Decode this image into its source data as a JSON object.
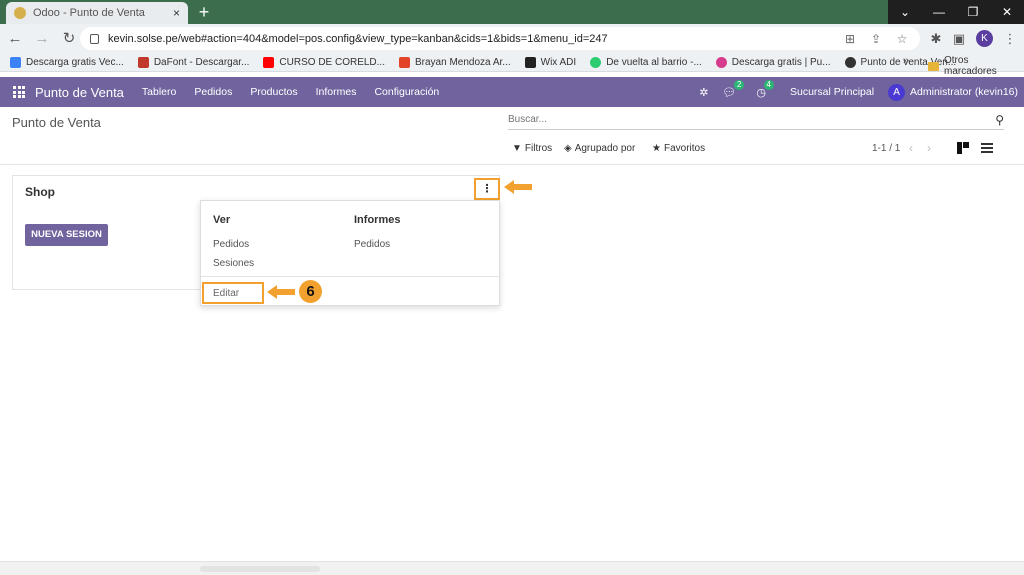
{
  "browser": {
    "tab_title": "Odoo - Punto de Venta",
    "tab_close": "×",
    "new_tab": "+",
    "url": "kevin.solse.pe/web#action=404&model=pos.config&view_type=kanban&cids=1&bids=1&menu_id=247",
    "profile_initial": "K",
    "window_controls": [
      "⌄",
      "—",
      "❐",
      "✕"
    ],
    "bookmarks": [
      {
        "label": "Descarga gratis Vec...",
        "color": "#3b82f6"
      },
      {
        "label": "DaFont - Descargar...",
        "color": "#c0392b"
      },
      {
        "label": "CURSO DE CORELD...",
        "color": "#ff0000"
      },
      {
        "label": "Brayan Mendoza Ar...",
        "color": "#e24329"
      },
      {
        "label": "Wix ADI",
        "color": "#222222"
      },
      {
        "label": "De vuelta al barrio -...",
        "color": "#2ecc71"
      },
      {
        "label": "Descarga gratis | Pu...",
        "color": "#d63c8c"
      },
      {
        "label": "Punto de venta Ven...",
        "color": "#333333"
      }
    ],
    "bookmarks_more": "»",
    "other_bookmarks": "Otros marcadores"
  },
  "navbar": {
    "brand": "Punto de Venta",
    "menu": [
      "Tablero",
      "Pedidos",
      "Productos",
      "Informes",
      "Configuración"
    ],
    "messages_badge": "2",
    "activities_badge": "4",
    "company": "Sucursal Principal",
    "user_initial": "A",
    "user_name": "Administrator (kevin16)"
  },
  "control_panel": {
    "breadcrumb": "Punto de Venta",
    "search_placeholder": "Buscar...",
    "filters": "Filtros",
    "group_by": "Agrupado por",
    "favorites": "Favoritos",
    "pager": "1-1 / 1"
  },
  "card": {
    "title": "Shop",
    "menu_glyph": "⋮",
    "new_session": "NUEVA SESION"
  },
  "dropdown": {
    "ver_heading": "Ver",
    "ver_items": [
      "Pedidos",
      "Sesiones"
    ],
    "informes_heading": "Informes",
    "informes_items": [
      "Pedidos"
    ],
    "edit": "Editar"
  },
  "annotations": {
    "step_number": "6",
    "accent_color": "#f2a12e"
  }
}
